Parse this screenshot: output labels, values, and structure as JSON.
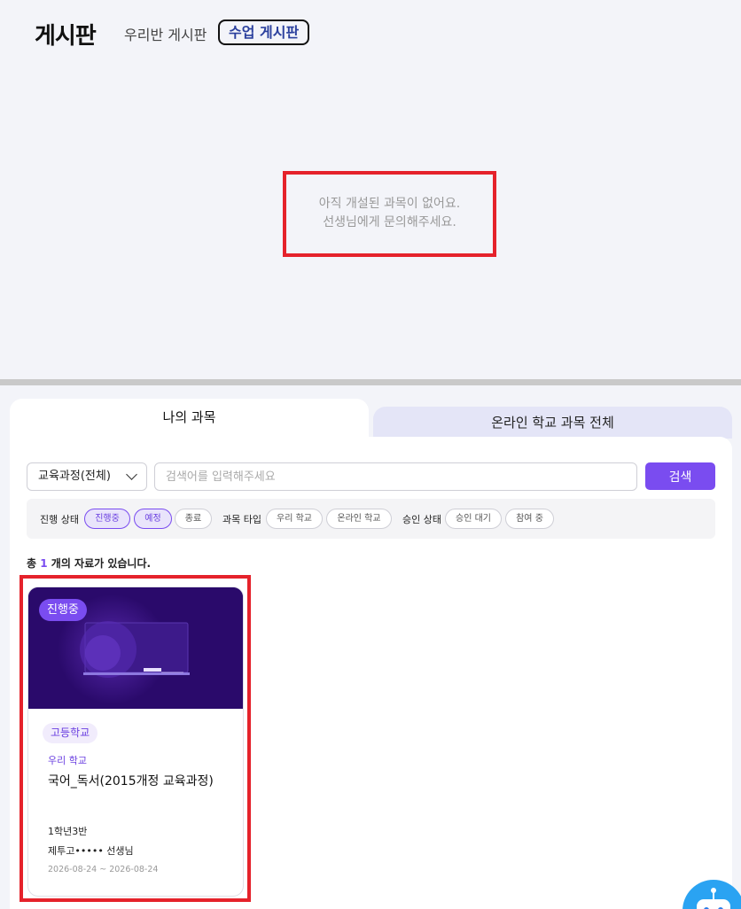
{
  "header": {
    "title": "게시판",
    "tabs": [
      {
        "label": "우리반 게시판",
        "active": false
      },
      {
        "label": "수업 게시판",
        "active": true
      }
    ]
  },
  "empty_message": {
    "line1": "아직 개설된 과목이 없어요.",
    "line2": "선생님에게 문의해주세요."
  },
  "course_tabs": [
    {
      "label": "나의 과목",
      "active": true
    },
    {
      "label": "온라인 학교 과목 전체",
      "active": false
    }
  ],
  "search": {
    "curriculum_selected": "교육과정(전체)",
    "placeholder": "검색어를 입력해주세요",
    "button_label": "검색"
  },
  "filters": {
    "progress": {
      "label": "진행 상태",
      "options": [
        {
          "label": "진행중",
          "selected": true
        },
        {
          "label": "예정",
          "selected": true
        },
        {
          "label": "종료",
          "selected": false
        }
      ]
    },
    "type": {
      "label": "과목 타입",
      "options": [
        {
          "label": "우리 학교",
          "selected": false
        },
        {
          "label": "온라인 학교",
          "selected": false
        }
      ]
    },
    "approval": {
      "label": "승인 상태",
      "options": [
        {
          "label": "승인 대기",
          "selected": false
        },
        {
          "label": "참여 중",
          "selected": false
        }
      ]
    }
  },
  "result_count": {
    "prefix": "총",
    "count": "1",
    "suffix": "개의 자료가 있습니다."
  },
  "courses": [
    {
      "status": "진행중",
      "grade": "고등학교",
      "school_type": "우리 학교",
      "name": "국어_독서(2015개정 교육과정)",
      "class": "1학년3반",
      "teacher": "제투고••••• 선생님",
      "dates": "2026-08-24 ~ 2026-08-24"
    }
  ],
  "colors": {
    "accent": "#7a4cf0",
    "highlight_border": "#e5222b",
    "thumb_bg": "#2a0a6b"
  },
  "icons": {
    "chevron": "chevron-down-icon",
    "chatbot": "chatbot-icon"
  }
}
